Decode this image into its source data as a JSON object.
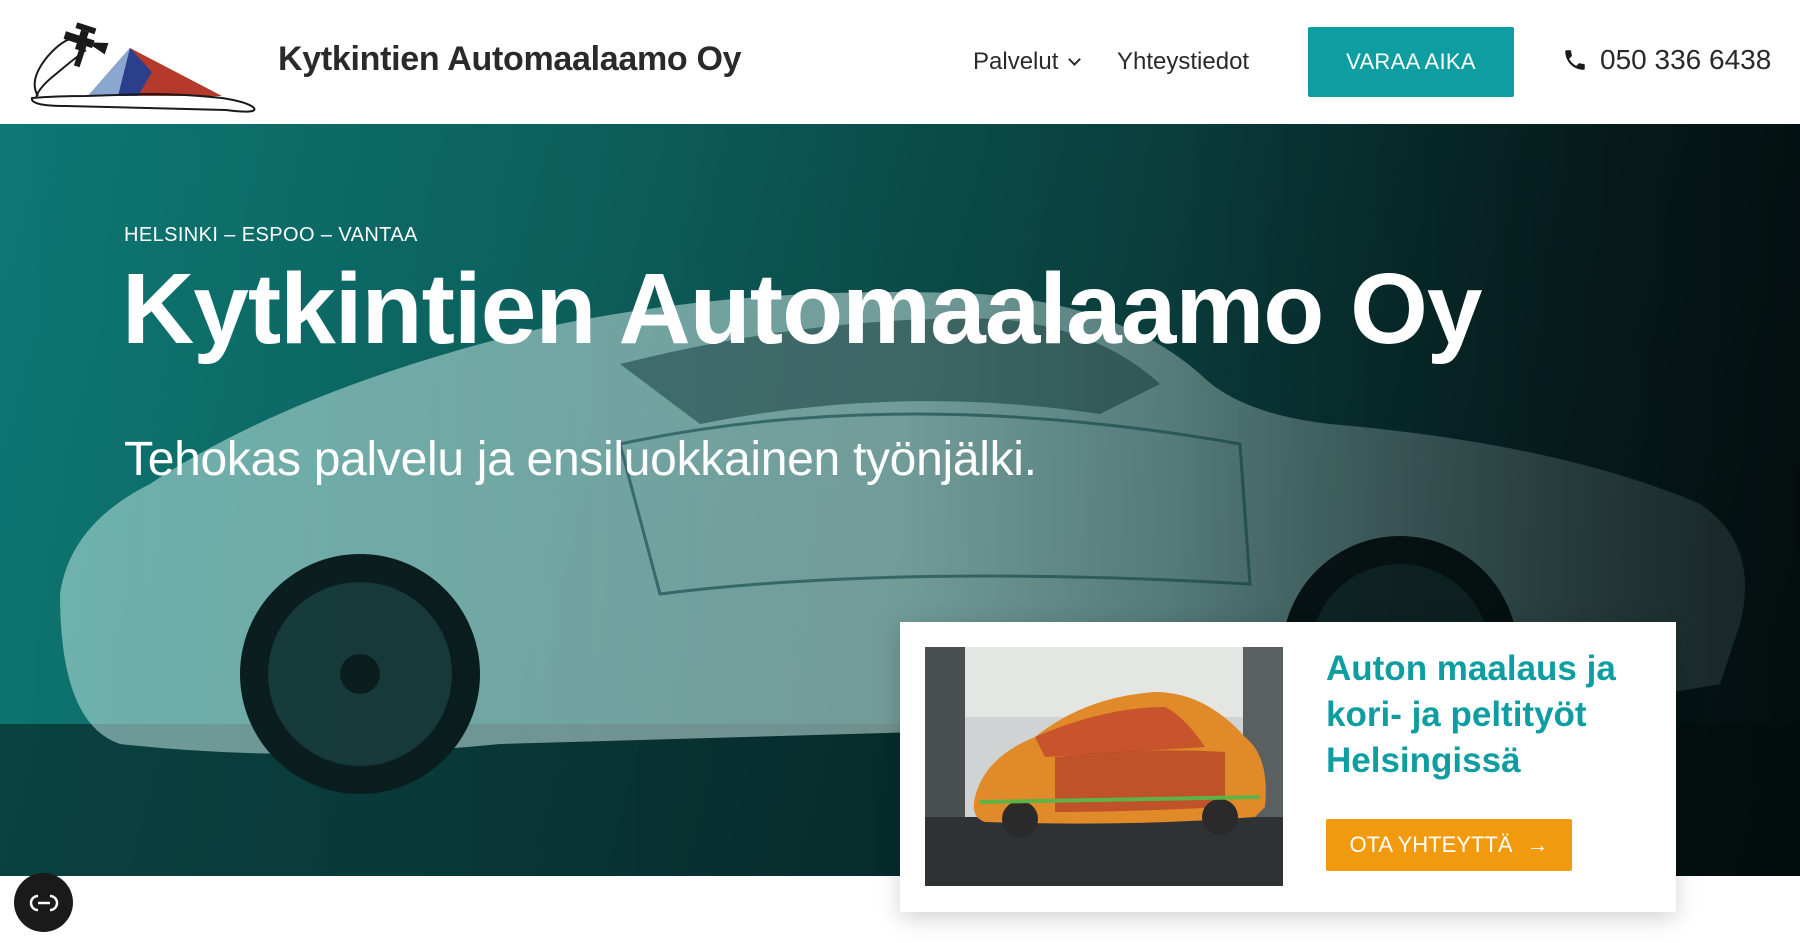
{
  "header": {
    "brand": "Kytkintien Automaalaamo Oy",
    "nav": [
      {
        "label": "Palvelut",
        "has_dropdown": true
      },
      {
        "label": "Yhteystiedot"
      }
    ],
    "cta_label": "VARAA AIKA",
    "phone": "050 336 6438"
  },
  "hero": {
    "locations": "HELSINKI – ESPOO – VANTAA",
    "title": "Kytkintien Automaalaamo Oy",
    "subtitle": "Tehokas palvelu ja ensiluokkainen työnjälki."
  },
  "card": {
    "title": "Auton maalaus ja kori- ja peltityöt Helsingissä",
    "button_label": "OTA YHTEYTTÄ",
    "button_icon": "arrow-right-icon"
  },
  "colors": {
    "accent_teal": "#0e9ea2",
    "accent_orange": "#f29a0e",
    "logo_blue": "#2b3f8c",
    "logo_red": "#b53a2c"
  },
  "icons": {
    "phone": "phone-icon",
    "dropdown": "chevron-down-icon",
    "accessibility": "accessibility-icon"
  }
}
